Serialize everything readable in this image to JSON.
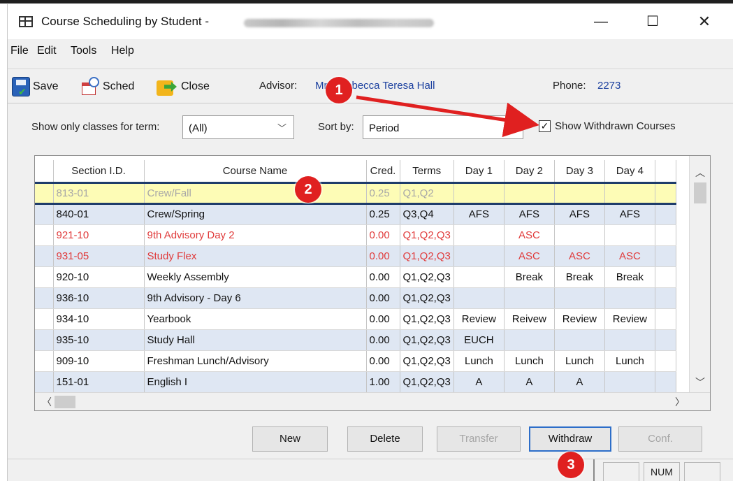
{
  "window": {
    "title": "Course Scheduling by Student - ",
    "minimize_glyph": "—",
    "maximize_glyph": "☐",
    "close_glyph": "✕"
  },
  "menu": [
    "File",
    "Edit",
    "Tools",
    "Help"
  ],
  "toolbar": {
    "save_label": "Save",
    "sched_label": "Sched",
    "close_label": "Close",
    "advisor_label": "Advisor:",
    "advisor_name": "Mrs. Rebecca Teresa Hall",
    "phone_label": "Phone:",
    "phone_value": "2273"
  },
  "filters": {
    "term_label": "Show only classes for term:",
    "term_value": "(All)",
    "sort_label": "Sort by:",
    "sort_value": "Period",
    "show_withdrawn_label": "Show Withdrawn Courses",
    "show_withdrawn_checked": true
  },
  "grid": {
    "columns": [
      "Section I.D.",
      "Course Name",
      "Cred.",
      "Terms",
      "Day 1",
      "Day 2",
      "Day 3",
      "Day 4"
    ],
    "rows": [
      {
        "state": "highlighted",
        "cells": [
          "813-01",
          "Crew/Fall",
          "0.25",
          "Q1,Q2",
          "",
          "",
          "",
          ""
        ]
      },
      {
        "state": "normal",
        "cells": [
          "840-01",
          "Crew/Spring",
          "0.25",
          "Q3,Q4",
          "AFS",
          "AFS",
          "AFS",
          "AFS"
        ]
      },
      {
        "state": "withdrawn",
        "cells": [
          "921-10",
          "9th Advisory Day 2",
          "0.00",
          "Q1,Q2,Q3",
          "",
          "ASC",
          "",
          ""
        ]
      },
      {
        "state": "withdrawn",
        "cells": [
          "931-05",
          "Study Flex",
          "0.00",
          "Q1,Q2,Q3",
          "",
          "ASC",
          "ASC",
          "ASC"
        ]
      },
      {
        "state": "normal",
        "cells": [
          "920-10",
          "Weekly Assembly",
          "0.00",
          "Q1,Q2,Q3",
          "",
          "Break",
          "Break",
          "Break"
        ]
      },
      {
        "state": "normal",
        "cells": [
          "936-10",
          "9th Advisory - Day 6",
          "0.00",
          "Q1,Q2,Q3",
          "",
          "",
          "",
          ""
        ]
      },
      {
        "state": "normal",
        "cells": [
          "934-10",
          "Yearbook",
          "0.00",
          "Q1,Q2,Q3",
          "Review",
          "Reivew",
          "Review",
          "Review"
        ]
      },
      {
        "state": "normal",
        "cells": [
          "935-10",
          "Study Hall",
          "0.00",
          "Q1,Q2,Q3",
          "EUCH",
          "",
          "",
          ""
        ]
      },
      {
        "state": "normal",
        "cells": [
          "909-10",
          "Freshman Lunch/Advisory",
          "0.00",
          "Q1,Q2,Q3",
          "Lunch",
          "Lunch",
          "Lunch",
          "Lunch"
        ]
      },
      {
        "state": "normal",
        "cells": [
          "151-01",
          "English I",
          "1.00",
          "Q1,Q2,Q3",
          "A",
          "A",
          "A",
          ""
        ]
      }
    ]
  },
  "buttons": {
    "new": "New",
    "delete": "Delete",
    "transfer": "Transfer",
    "withdraw": "Withdraw",
    "conf": "Conf."
  },
  "statusbar": {
    "num": "NUM"
  },
  "annotations": {
    "badge_1": "1",
    "badge_2": "2",
    "badge_3": "3",
    "arrow_color": "#e02020"
  }
}
